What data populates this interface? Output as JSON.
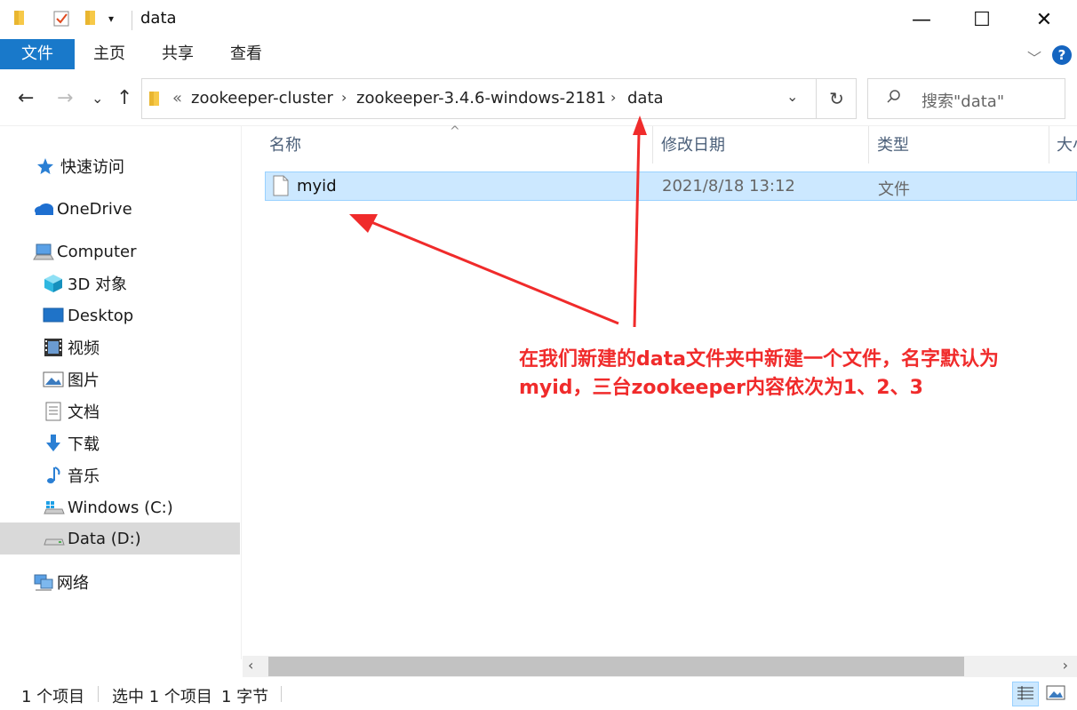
{
  "window": {
    "title": "data",
    "minimize_glyph": "—",
    "maximize_glyph": "☐",
    "close_glyph": "✕"
  },
  "ribbon": {
    "tabs": [
      "文件",
      "主页",
      "共享",
      "查看"
    ],
    "expand_glyph": "﹀",
    "help_glyph": "?"
  },
  "address": {
    "prefix": "«",
    "crumbs": [
      "zookeeper-cluster",
      "zookeeper-3.4.6-windows-2181",
      "data"
    ],
    "separator": "›",
    "dropdown_glyph": "⌄",
    "refresh_glyph": "↻"
  },
  "search": {
    "placeholder": "搜索\"data\""
  },
  "nav": {
    "back_glyph": "←",
    "forward_glyph": "→",
    "recent_glyph": "⌄",
    "up_glyph": "↑",
    "items": [
      {
        "label": "快速访问",
        "icon": "star-icon"
      },
      {
        "label": "OneDrive",
        "icon": "cloud-icon"
      },
      {
        "label": "Computer",
        "icon": "computer-icon"
      },
      {
        "label": "3D 对象",
        "icon": "cube-icon"
      },
      {
        "label": "Desktop",
        "icon": "desktop-icon"
      },
      {
        "label": "视频",
        "icon": "film-icon"
      },
      {
        "label": "图片",
        "icon": "picture-icon"
      },
      {
        "label": "文档",
        "icon": "document-icon"
      },
      {
        "label": "下载",
        "icon": "download-icon"
      },
      {
        "label": "音乐",
        "icon": "music-icon"
      },
      {
        "label": "Windows (C:)",
        "icon": "windows-drive-icon"
      },
      {
        "label": "Data (D:)",
        "icon": "drive-icon"
      },
      {
        "label": "网络",
        "icon": "network-icon"
      }
    ]
  },
  "columns": {
    "name": "名称",
    "modified": "修改日期",
    "type": "类型",
    "size": "大小",
    "sort_glyph": "^"
  },
  "files": [
    {
      "name": "myid",
      "modified": "2021/8/18 13:12",
      "type": "文件"
    }
  ],
  "annotation": {
    "line1": "在我们新建的data文件夹中新建一个文件，名字默认为",
    "line2": "myid，三台zookeeper内容依次为1、2、3",
    "color": "#f02b2b"
  },
  "scrollbar": {
    "left_glyph": "‹",
    "right_glyph": "›"
  },
  "status": {
    "count": "1 个项目",
    "selected": "选中 1 个项目",
    "size": "1 字节"
  },
  "colors": {
    "accent": "#1979ca",
    "selection": "#cce8ff",
    "selection_border": "#99d1ff",
    "folder": "#f7c948"
  }
}
